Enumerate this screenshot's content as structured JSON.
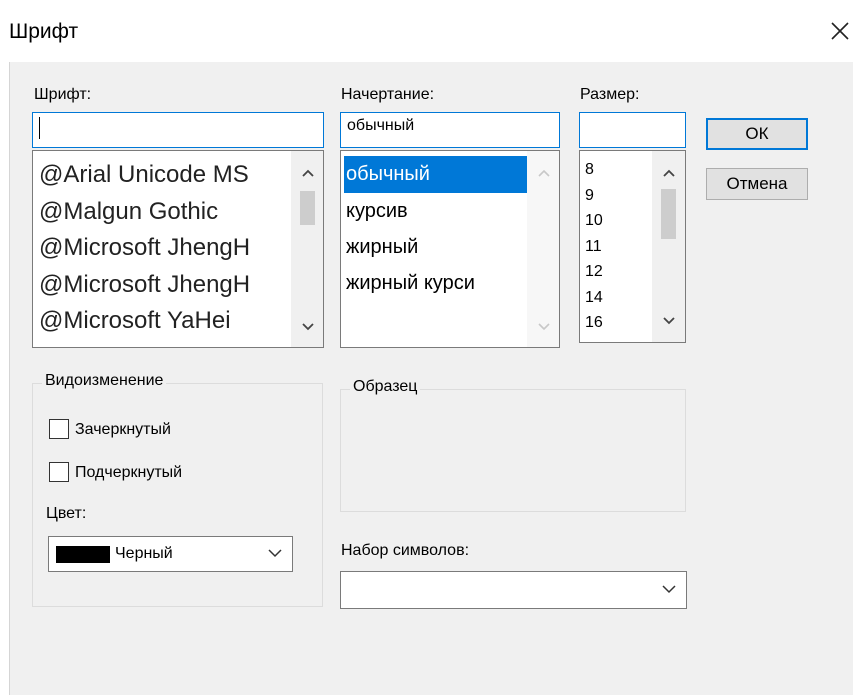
{
  "dialog": {
    "title": "Шрифт",
    "close_icon": "close-icon"
  },
  "font": {
    "label": "Шрифт:",
    "value": "",
    "items": [
      "@Arial Unicode MS",
      "@Malgun Gothic",
      "@Microsoft JhengH",
      "@Microsoft JhengH",
      "@Microsoft YaHei"
    ]
  },
  "style": {
    "label": "Начертание:",
    "value": "обычный",
    "items": [
      "обычный",
      "курсив",
      "жирный",
      "жирный курси"
    ],
    "selected_index": 0
  },
  "size": {
    "label": "Размер:",
    "value": "",
    "items": [
      "8",
      "9",
      "10",
      "11",
      "12",
      "14",
      "16"
    ]
  },
  "buttons": {
    "ok": "ОК",
    "cancel": "Отмена"
  },
  "effects": {
    "title": "Видоизменение",
    "strikeout": "Зачеркнутый",
    "underline": "Подчеркнутый",
    "strikeout_checked": false,
    "underline_checked": false,
    "color_label": "Цвет:",
    "color_value": "Черный",
    "color_swatch": "#000000"
  },
  "sample": {
    "title": "Образец"
  },
  "charset": {
    "label": "Набор символов:",
    "value": ""
  },
  "colors": {
    "selection": "#0078d7",
    "focus_border": "#0078d7",
    "client_bg": "#f0f0f0"
  }
}
